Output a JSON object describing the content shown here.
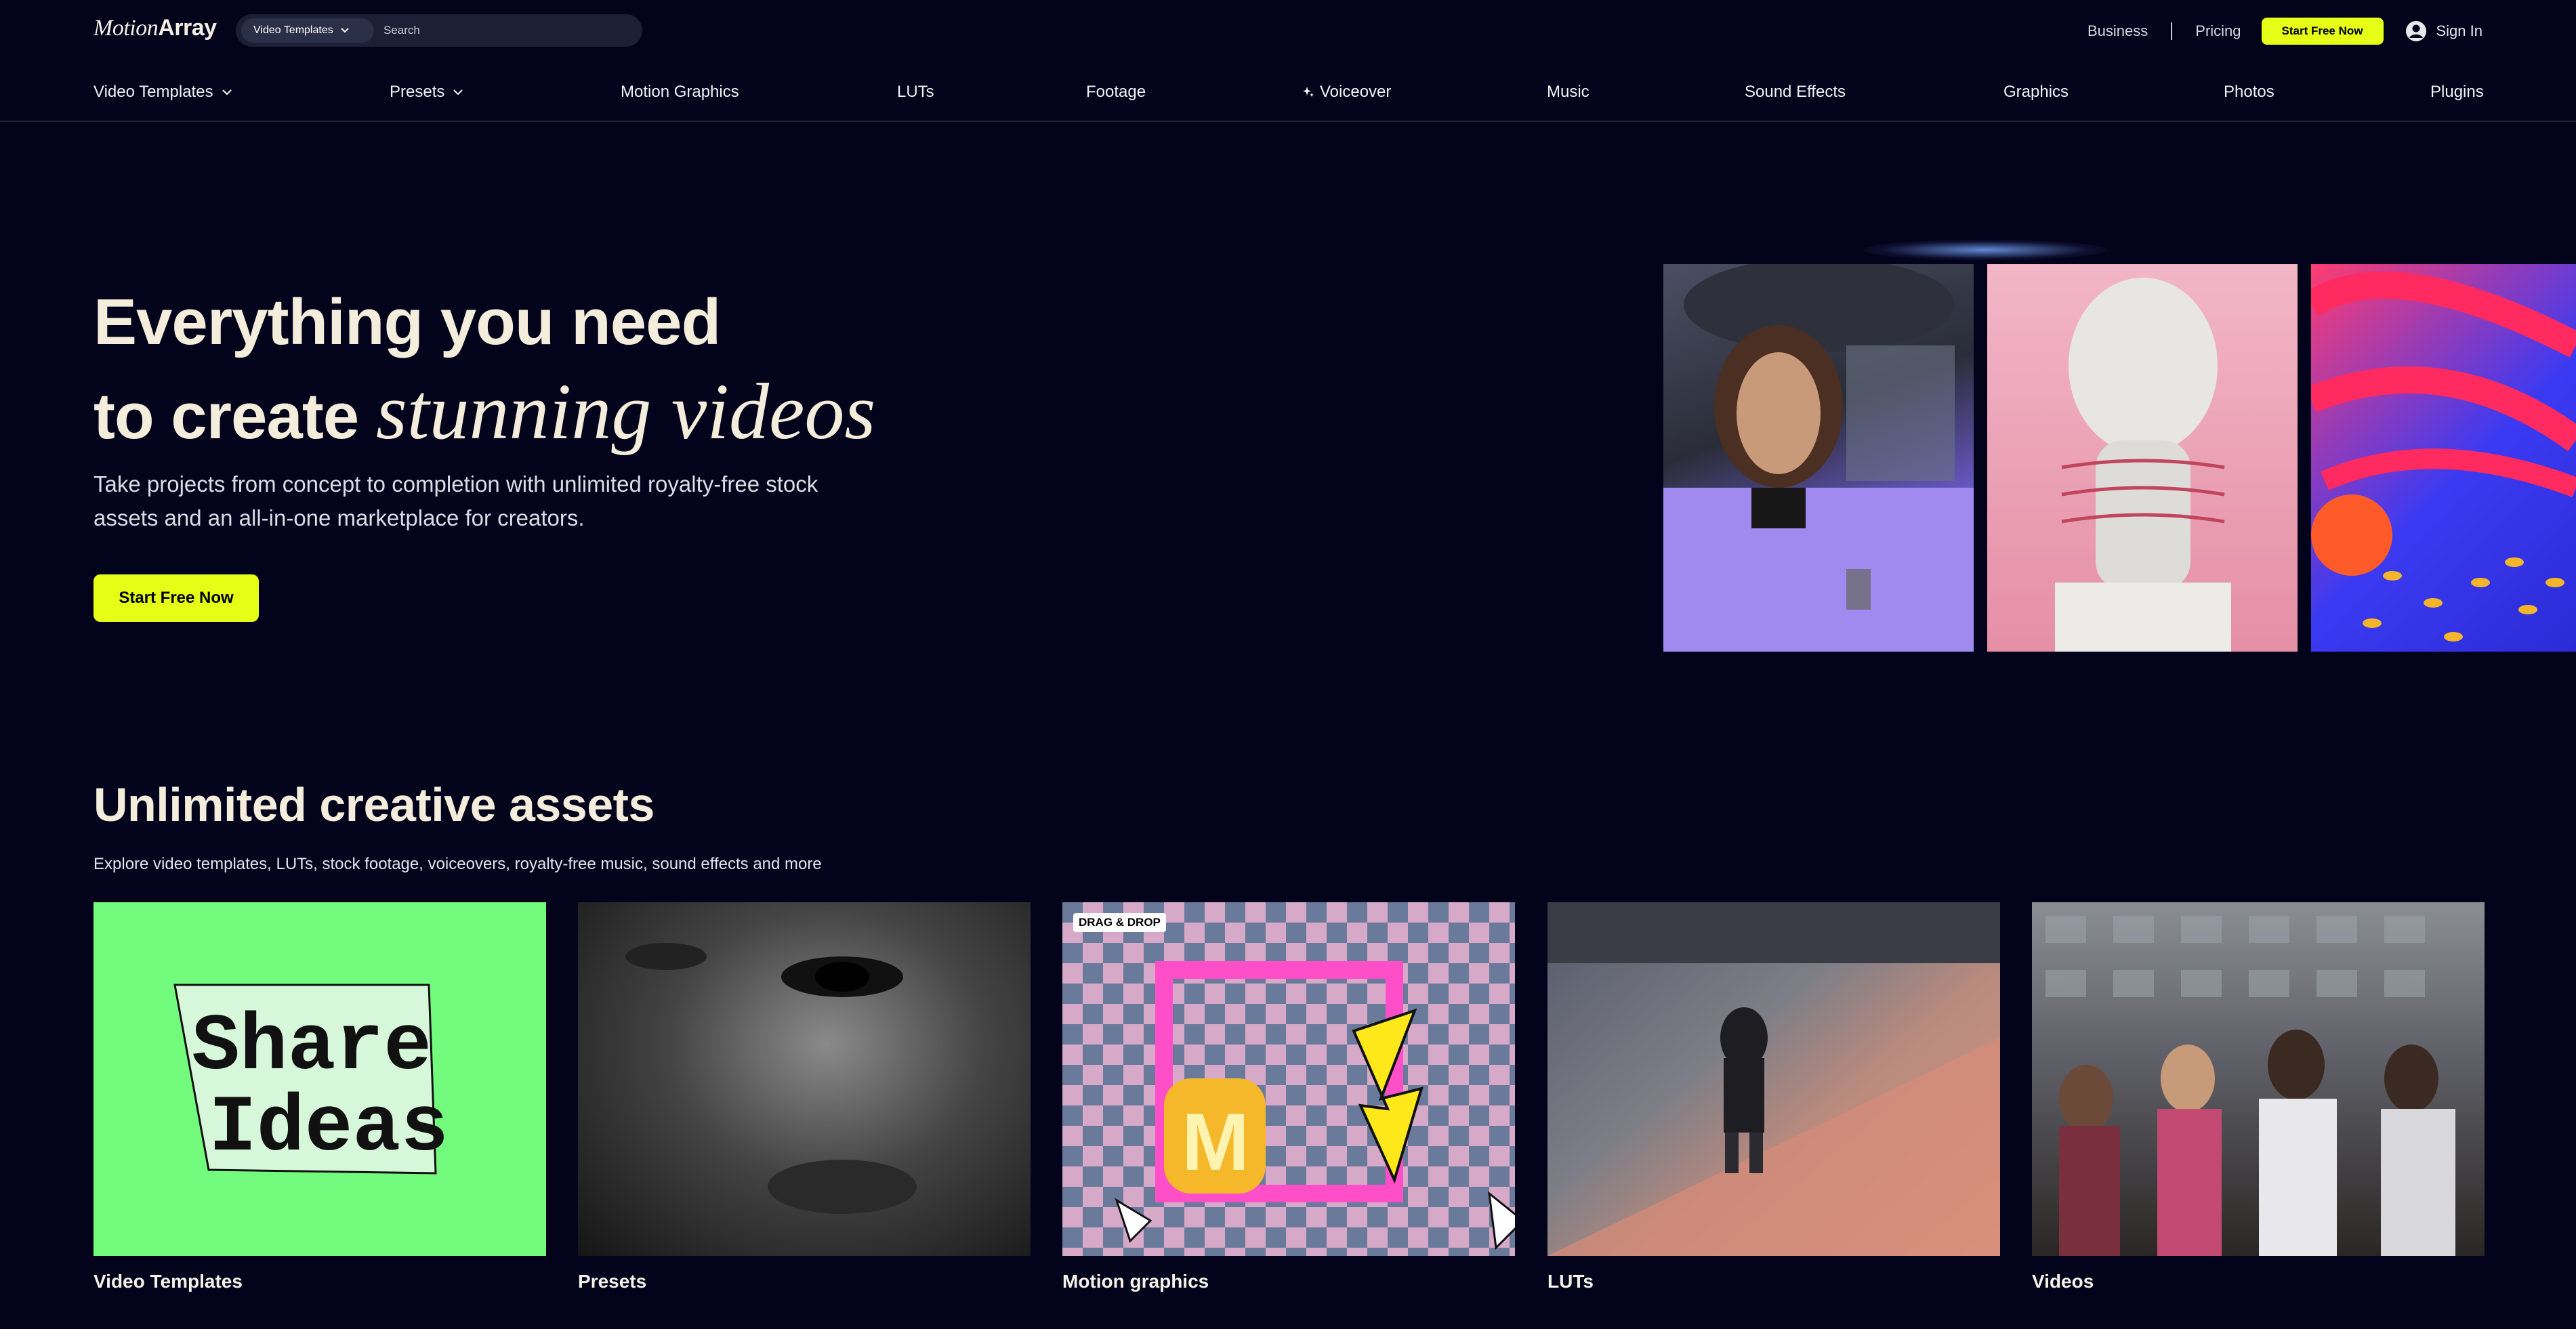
{
  "header": {
    "logo_motion": "Motion",
    "logo_array": "Array",
    "search": {
      "category": "Video Templates",
      "placeholder": "Search"
    },
    "links": {
      "business": "Business",
      "separator": "|",
      "pricing": "Pricing"
    },
    "cta": "Start Free Now",
    "signin": "Sign In"
  },
  "category_nav": {
    "items": [
      {
        "label": "Video Templates",
        "dropdown": true
      },
      {
        "label": "Presets",
        "dropdown": true
      },
      {
        "label": "Motion Graphics"
      },
      {
        "label": "LUTs"
      },
      {
        "label": "Footage"
      },
      {
        "label": "Voiceover",
        "icon": "sparkle-icon"
      },
      {
        "label": "Music"
      },
      {
        "label": "Sound Effects"
      },
      {
        "label": "Graphics"
      },
      {
        "label": "Photos"
      },
      {
        "label": "Plugins"
      }
    ]
  },
  "hero": {
    "title_line1": "Everything you need",
    "title_line2_plain": "to create ",
    "title_line2_italic": "stunning videos",
    "subtitle": "Take projects from concept to completion with unlimited royalty-free stock assets and an all-in-one marketplace for creators.",
    "cta": "Start Free Now"
  },
  "assets_section": {
    "title": "Unlimited creative assets",
    "subtitle": "Explore video templates, LUTs, stock footage, voiceovers, royalty-free music, sound effects and more",
    "cards": [
      {
        "label": "Video Templates",
        "thumb_text_1": "Share",
        "thumb_text_2": "Ideas"
      },
      {
        "label": "Presets"
      },
      {
        "label": "Motion graphics",
        "badge": "DRAG & DROP",
        "thumb_letter": "M"
      },
      {
        "label": "LUTs"
      },
      {
        "label": "Videos"
      }
    ]
  },
  "colors": {
    "background": "#03041c",
    "accent": "#e5ff17",
    "headline": "#f5eddc"
  }
}
